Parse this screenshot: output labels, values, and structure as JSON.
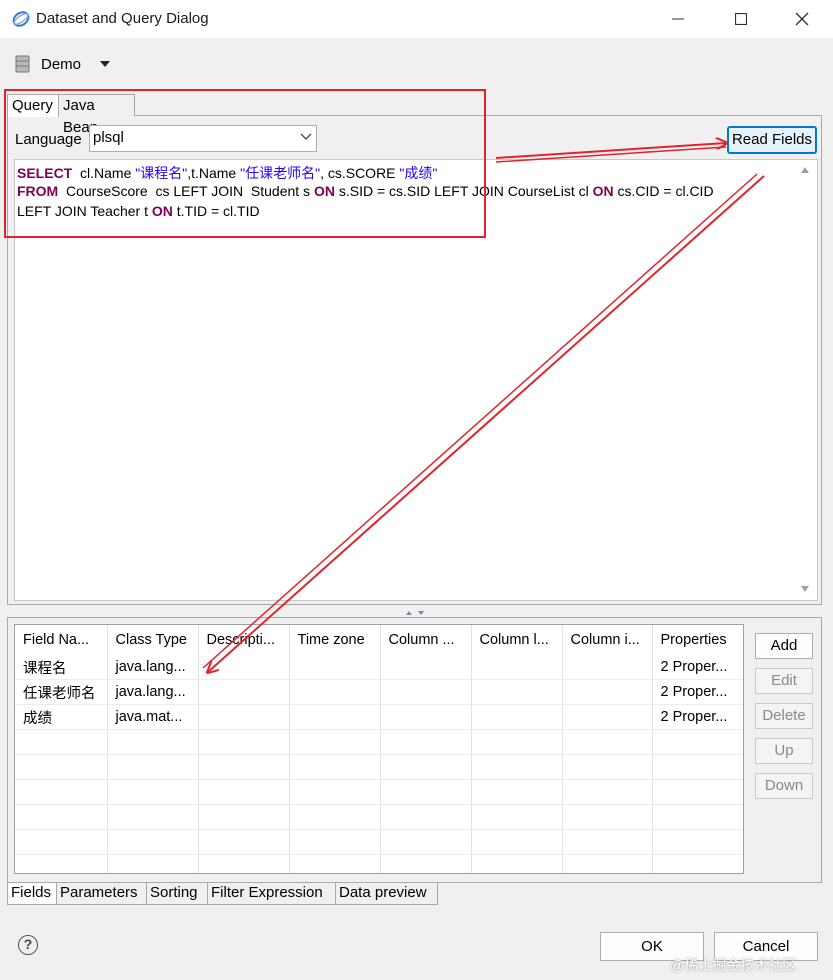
{
  "window": {
    "title": "Dataset and Query Dialog",
    "app_icon": "eclipse-birt-icon"
  },
  "data_source": {
    "name": "Demo",
    "icon": "database-icon"
  },
  "top_tabs": [
    {
      "label": "Query",
      "active": true
    },
    {
      "label": "Java Bean",
      "active": false
    }
  ],
  "language": {
    "label": "Language",
    "value": "plsql"
  },
  "read_fields_label": "Read Fields",
  "sql": {
    "line1": {
      "kw1": "SELECT",
      "t1": "  cl.Name ",
      "s1": "\"课程名\"",
      "t2": ",t.Name ",
      "s2": "\"任课老师名\"",
      "t3": ", cs.SCORE ",
      "s3": "\"成绩\""
    },
    "line2": {
      "kw1": "FROM",
      "t1": "  CourseScore  cs LEFT JOIN  Student s ",
      "kw2": "ON",
      "t2": " s.SID = cs.SID LEFT JOIN CourseList cl ",
      "kw3": "ON",
      "t3": " cs.CID = cl.CID"
    },
    "line3": {
      "t1": "LEFT JOIN Teacher t ",
      "kw1": "ON",
      "t2": " t.TID = cl.TID"
    }
  },
  "fields_table": {
    "columns": [
      "Field Na...",
      "Class Type",
      "Descripti...",
      "Time zone",
      "Column ...",
      "Column l...",
      "Column i...",
      "Properties"
    ],
    "rows": [
      [
        "课程名",
        "java.lang...",
        "",
        "",
        "",
        "",
        "",
        "2 Proper..."
      ],
      [
        "任课老师名",
        "java.lang...",
        "",
        "",
        "",
        "",
        "",
        "2 Proper..."
      ],
      [
        "成绩",
        "java.mat...",
        "",
        "",
        "",
        "",
        "",
        "2 Proper..."
      ]
    ]
  },
  "side_buttons": {
    "add": "Add",
    "edit": "Edit",
    "delete": "Delete",
    "up": "Up",
    "down": "Down"
  },
  "bottom_tabs": [
    {
      "label": "Fields",
      "active": true
    },
    {
      "label": "Parameters",
      "active": false
    },
    {
      "label": "Sorting",
      "active": false
    },
    {
      "label": "Filter Expression",
      "active": false
    },
    {
      "label": "Data preview",
      "active": false
    }
  ],
  "help_icon": "help-icon",
  "ok_label": "OK",
  "cancel_label": "Cancel",
  "watermark": "@稀土掘金技术社区",
  "annotation_color": "#e0242e"
}
